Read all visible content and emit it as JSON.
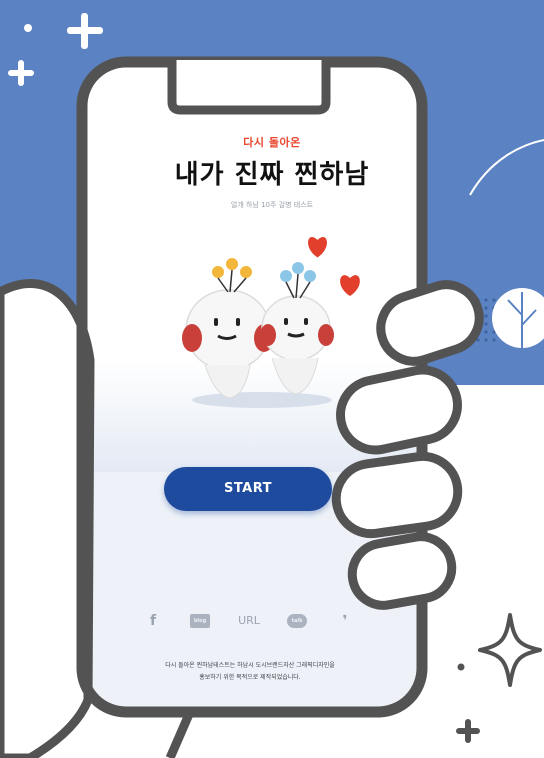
{
  "screen": {
    "subtitle": "다시 돌아온",
    "title": "내가 진짜 찐하남",
    "caption": "얼개 하남 10주 걸병 테스트",
    "start_label": "START"
  },
  "share": {
    "facebook": "f",
    "blog": "blog",
    "url": "URL",
    "talk": "talk",
    "story": "❜"
  },
  "footer": {
    "line1": "다시 돌아온 찐하남테스트는 하남시 도시브랜드자산 그래픽디자인을",
    "line2": "홍보하기 위한 목적으로 제작되었습니다."
  },
  "colors": {
    "background_blue": "#5b82c2",
    "accent_red": "#e8452c",
    "button_blue": "#1f4b9e",
    "outline": "#535353"
  }
}
